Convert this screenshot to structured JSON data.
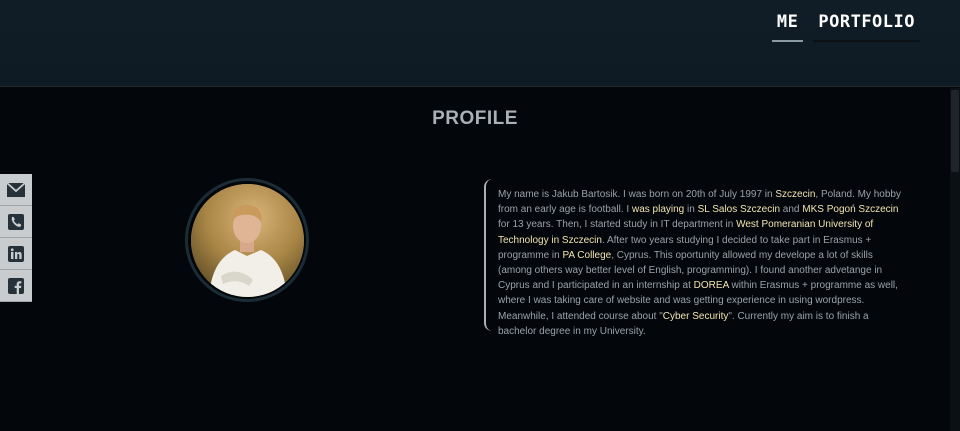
{
  "nav": {
    "items": [
      {
        "label": "ME",
        "active": true
      },
      {
        "label": "PORTFOLIO",
        "active": false
      }
    ]
  },
  "profile": {
    "title": "PROFILE",
    "bio": [
      {
        "t": "My name is Jakub Bartosik. I was born on 20th of July 1997 in ",
        "hl": false
      },
      {
        "t": "Szczecin",
        "hl": true
      },
      {
        "t": ", Poland. My hobby from an early age is football. I ",
        "hl": false
      },
      {
        "t": "was playing",
        "hl": true
      },
      {
        "t": " in ",
        "hl": false
      },
      {
        "t": "SL Salos Szczecin",
        "hl": true
      },
      {
        "t": " and ",
        "hl": false
      },
      {
        "t": "MKS Pogoń Szczecin",
        "hl": true
      },
      {
        "t": " for 13 years. Then, I started study in IT department in ",
        "hl": false
      },
      {
        "t": "West Pomeranian University of Technology in Szczecin",
        "hl": true
      },
      {
        "t": ". After two years studying I decided to take part in Erasmus + programme in ",
        "hl": false
      },
      {
        "t": "PA College",
        "hl": true
      },
      {
        "t": ", Cyprus. This oportunity allowed my develope a lot of skills (among others way better level of English, programming). I found another advetange in Cyprus and I participated in an internship at ",
        "hl": false
      },
      {
        "t": "DOREA",
        "hl": true
      },
      {
        "t": " within Erasmus + programme as well, where I was taking care of website and was getting experience in using wordpress. Meanwhile, I attended course about \"",
        "hl": false
      },
      {
        "t": "Cyber Security",
        "hl": true
      },
      {
        "t": "\". Currently my aim is to finish a bachelor degree in my University.",
        "hl": false
      }
    ]
  },
  "social": [
    {
      "icon": "envelope-icon"
    },
    {
      "icon": "phone-icon"
    },
    {
      "icon": "linkedin-icon"
    },
    {
      "icon": "facebook-icon"
    }
  ],
  "colors": {
    "highlight": "#f3e3b0",
    "text": "#9aa2a7",
    "background": "#03070b",
    "topbar": "#0f1b25"
  }
}
